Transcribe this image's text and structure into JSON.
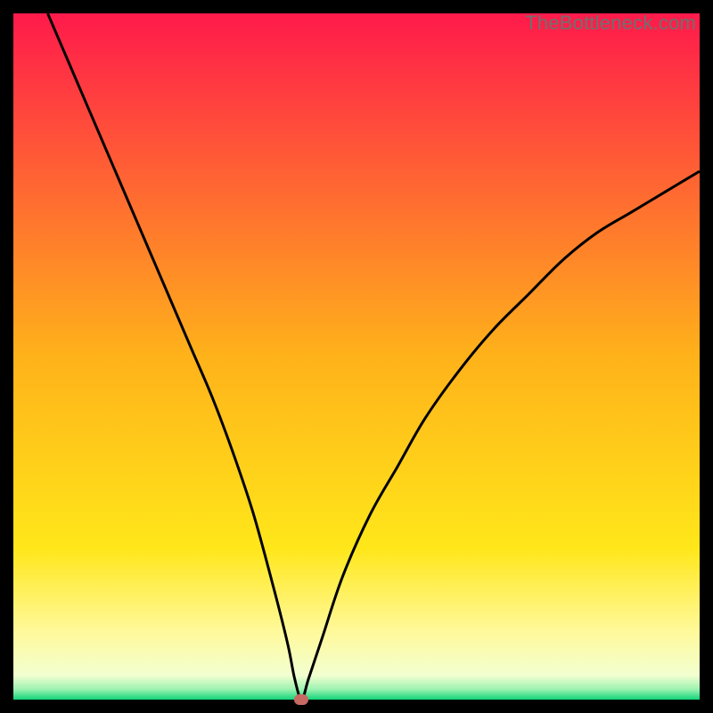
{
  "watermark": "TheBottleneck.com",
  "chart_data": {
    "type": "line",
    "title": "",
    "xlabel": "",
    "ylabel": "",
    "xlim": [
      0,
      100
    ],
    "ylim": [
      0,
      100
    ],
    "grid": false,
    "legend": false,
    "background_gradient": {
      "stops": [
        {
          "offset": 0.0,
          "color": "#ff1a4b"
        },
        {
          "offset": 0.5,
          "color": "#ffb21a"
        },
        {
          "offset": 0.78,
          "color": "#ffe71a"
        },
        {
          "offset": 0.9,
          "color": "#fff99a"
        },
        {
          "offset": 0.965,
          "color": "#f2ffd0"
        },
        {
          "offset": 0.985,
          "color": "#9bf2b0"
        },
        {
          "offset": 1.0,
          "color": "#12d47a"
        }
      ]
    },
    "bottleneck_point": {
      "x": 42,
      "y": 0,
      "color": "#c76a63"
    },
    "series": [
      {
        "name": "bottleneck-curve",
        "color": "#000000",
        "x": [
          5,
          8,
          11,
          14,
          17,
          20,
          23,
          26,
          29,
          32,
          35,
          38,
          40,
          41,
          42,
          43,
          45,
          48,
          52,
          56,
          60,
          65,
          70,
          75,
          80,
          85,
          90,
          95,
          100
        ],
        "y": [
          100,
          93,
          86,
          79,
          72,
          65,
          58,
          51,
          44,
          36,
          27,
          16,
          8,
          3,
          0,
          3,
          9,
          18,
          27,
          34,
          41,
          48,
          54,
          59,
          64,
          68,
          71,
          74,
          77
        ]
      }
    ]
  }
}
